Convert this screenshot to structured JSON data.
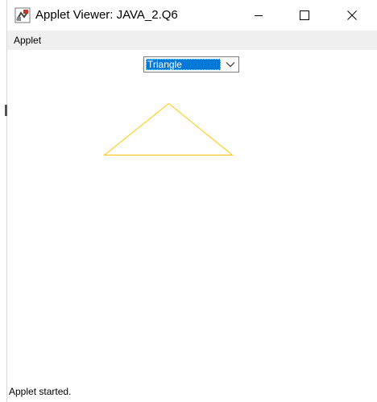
{
  "window": {
    "title": "Applet Viewer: JAVA_2.Q6"
  },
  "menubar": {
    "items": [
      {
        "label": "Applet"
      }
    ]
  },
  "choice": {
    "selected": "Triangle"
  },
  "drawing": {
    "shape": "triangle",
    "stroke_color": "#ffc800"
  },
  "status": {
    "text": "Applet started."
  },
  "icons": {
    "app": "java-applet-icon",
    "minimize": "minimize-icon",
    "maximize": "maximize-icon",
    "close": "close-icon",
    "dropdown": "chevron-down-icon"
  }
}
